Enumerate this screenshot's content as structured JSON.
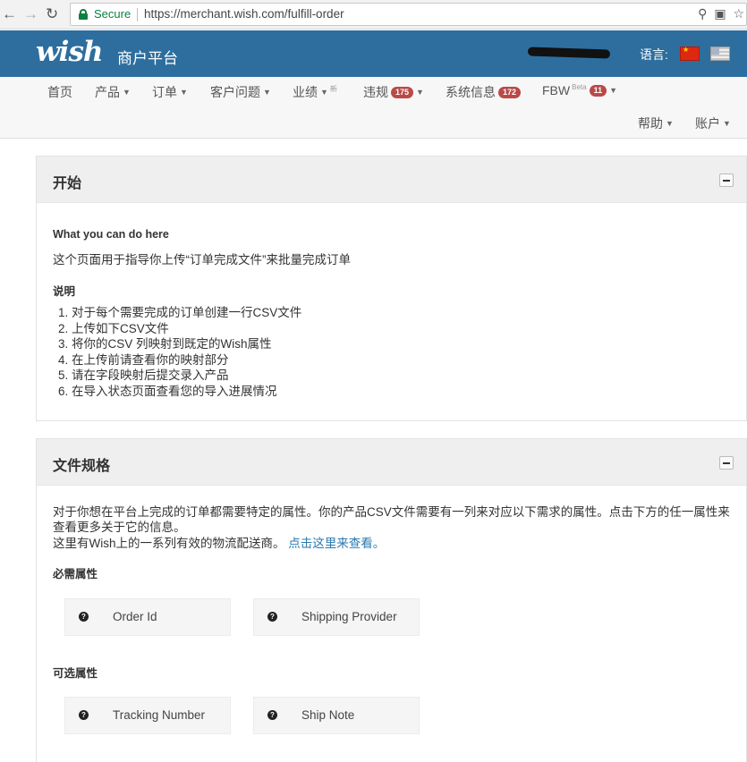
{
  "browser": {
    "back_icon": "back-arrow-icon",
    "forward_icon": "forward-arrow-icon",
    "reload_icon": "reload-icon",
    "secure_label": "Secure",
    "url": "https://merchant.wish.com/fulfill-order",
    "zoom_icon": "zoom-icon",
    "translate_icon": "translate-icon",
    "bookmark_icon": "star-icon"
  },
  "header": {
    "logo": "wish",
    "platform": "商户平台",
    "language_label": "语言:",
    "bg_color": "#2d6e9e"
  },
  "nav": {
    "items": [
      {
        "label": "首页"
      },
      {
        "label": "产品"
      },
      {
        "label": "订单"
      },
      {
        "label": "客户问题"
      },
      {
        "label": "业绩",
        "sup": "新"
      },
      {
        "label": "违规",
        "badge": "175"
      },
      {
        "label": "系统信息",
        "badge": "172"
      },
      {
        "label": "FBW",
        "sup": "Beta",
        "badge": "11"
      },
      {
        "label": "帮助"
      },
      {
        "label": "账户"
      }
    ],
    "badge_color": "#b94a48"
  },
  "start_panel": {
    "title": "开始",
    "subheading": "What you can do here",
    "description": "这个页面用于指导你上传“订单完成文件”来批量完成订单",
    "instructions_heading": "说明",
    "steps": [
      "1. 对于每个需要完成的订单创建一行CSV文件",
      "2. 上传如下CSV文件",
      "3. 将你的CSV 列映射到既定的Wish属性",
      "4. 在上传前请查看你的映射部分",
      "5. 请在字段映射后提交录入产品",
      "6. 在导入状态页面查看您的导入进展情况"
    ]
  },
  "spec_panel": {
    "title": "文件规格",
    "desc_line1": "对于你想在平台上完成的订单都需要特定的属性。你的产品CSV文件需要有一列来对应以下需求的属性。点击下方的任一属性来",
    "desc_line2": "查看更多关于它的信息。",
    "desc_line3": "这里有Wish上的一系列有效的物流配送商。",
    "link_text": "点击这里来查看。",
    "link_color": "#2a7ab0",
    "required_heading": "必需属性",
    "required": [
      {
        "label": "Order Id",
        "icon": "question-icon"
      },
      {
        "label": "Shipping Provider",
        "icon": "question-icon"
      }
    ],
    "optional_heading": "可选属性",
    "optional": [
      {
        "label": "Tracking Number",
        "icon": "question-icon"
      },
      {
        "label": "Ship Note",
        "icon": "question-icon"
      }
    ]
  }
}
